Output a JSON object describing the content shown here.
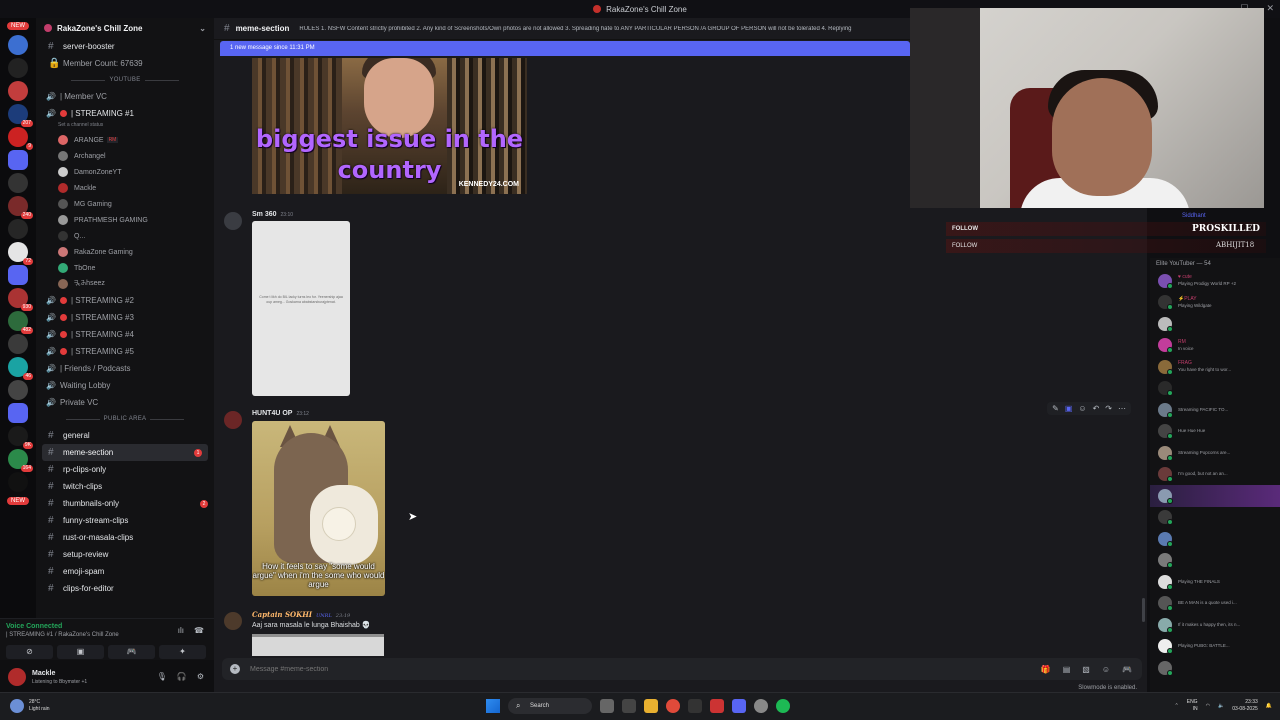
{
  "window": {
    "title": "RakaZone's Chill Zone"
  },
  "server": {
    "name": "RakaZone's Chill Zone",
    "new_label": "NEW",
    "rail_badges": [
      "207",
      "9",
      "240",
      "72",
      "930",
      "482",
      "46",
      "9K",
      "164"
    ]
  },
  "sidebar": {
    "top_channels": [
      {
        "name": "server-booster",
        "type": "text"
      },
      {
        "name": "Member Count: 67639",
        "type": "voice"
      }
    ],
    "youtube_category": "YOUTUBE",
    "member_vc": "| Member VC",
    "streaming1": "| STREAMING #1",
    "streaming1_status": "Set a channel status",
    "vc_users": [
      {
        "name": "ARANGE",
        "tag": "RM"
      },
      {
        "name": "Archangel",
        "tag": ""
      },
      {
        "name": "DamonZoneYT",
        "tag": ""
      },
      {
        "name": "Mackle",
        "tag": ""
      },
      {
        "name": "MG Gaming",
        "tag": ""
      },
      {
        "name": "PRATHMESH GAMING",
        "tag": ""
      },
      {
        "name": "Q...",
        "tag": ""
      },
      {
        "name": "RakaZone Gaming",
        "tag": ""
      },
      {
        "name": "TbOne",
        "tag": ""
      },
      {
        "name": "ꔩꔕhseez",
        "tag": ""
      }
    ],
    "other_vcs": [
      "| STREAMING #2",
      "| STREAMING #3",
      "| STREAMING #4",
      "| STREAMING #5",
      "| Friends / Podcasts",
      "Waiting Lobby",
      "Private VC"
    ],
    "public_category": "PUBLIC AREA",
    "text_channels": [
      {
        "name": "general",
        "unread": ""
      },
      {
        "name": "meme-section",
        "unread": "1"
      },
      {
        "name": "rp-clips-only",
        "unread": ""
      },
      {
        "name": "twitch-clips",
        "unread": ""
      },
      {
        "name": "thumbnails-only",
        "unread": "2"
      },
      {
        "name": "funny-stream-clips",
        "unread": ""
      },
      {
        "name": "rust-or-masala-clips",
        "unread": ""
      },
      {
        "name": "setup-review",
        "unread": ""
      },
      {
        "name": "emoji-spam",
        "unread": ""
      },
      {
        "name": "clips-for-editor",
        "unread": ""
      }
    ]
  },
  "voice_panel": {
    "status": "Voice Connected",
    "channel": "| STREAMING #1 / RakaZone's Chill Zone"
  },
  "user_panel": {
    "name": "Mackle",
    "status": "Listening to Bbymster +1"
  },
  "channel": {
    "name": "meme-section",
    "topic": "RULES 1. NSFW Content strictly prohibited 2. Any kind of Screenshots/Own photos are not allowed 3. Spreading hate to ANY PARTICULAR PERSON /A GROUP OF PERSON will not be tolerated 4. Replying",
    "new_message_bar": "1 new message since 11:31 PM"
  },
  "messages": [
    {
      "author": "",
      "time": "",
      "image_caption": "biggest issue in the country",
      "watermark": "KENNEDY24.COM"
    },
    {
      "author": "Sm 360",
      "time": "23:10",
      "image_text": "Come t likh do BIL lacky turns leo for. Yeenership ajaa oup ameg... Goskarna ababstarsburajptenat."
    },
    {
      "author": "HUNT4U OP",
      "time": "23:12",
      "image_caption": "How it feels to say \"some would argue\" when i'm the some who would argue"
    },
    {
      "author": "Captain SOKHI",
      "tag": "UNRL",
      "time": "23:19",
      "text": "Aaj sara masala le lunga Bhaishab 💀"
    }
  ],
  "composer": {
    "placeholder": "Message #meme-section",
    "slowmode": "Slowmode is enabled."
  },
  "stream_overlay": {
    "follow1": "FOLLOW",
    "follow2": "FOLLOW",
    "name1": "PROSKILLED",
    "name2": "ABHIJIT18",
    "top_member": "Siddhant"
  },
  "members": {
    "category": "Elite YouTuber — 54",
    "list": [
      {
        "name": "♥ cute",
        "activity": "Playing Prodigy World RP +2"
      },
      {
        "name": "⚡PLAY",
        "activity": "Playing Wildgate"
      },
      {
        "name": "",
        "activity": ""
      },
      {
        "name": "RM",
        "activity": "In voice"
      },
      {
        "name": "FRAG",
        "activity": "You have the right to wor..."
      },
      {
        "name": "",
        "activity": ""
      },
      {
        "name": "",
        "activity": "Streaming PACIFIC TO..."
      },
      {
        "name": "",
        "activity": "Hue Hue Hue"
      },
      {
        "name": "",
        "activity": "Streaming Popcorns are..."
      },
      {
        "name": "",
        "activity": "I'm good, but not an an..."
      },
      {
        "name": "",
        "activity": ""
      },
      {
        "name": "",
        "activity": ""
      },
      {
        "name": "",
        "activity": ""
      },
      {
        "name": "",
        "activity": ""
      },
      {
        "name": "",
        "activity": "Playing THE FINALS"
      },
      {
        "name": "",
        "activity": "BE A MAN is a quote used i..."
      },
      {
        "name": "",
        "activity": "If it makes u happy then, its n..."
      },
      {
        "name": "",
        "activity": "Playing PUBG: BATTLE..."
      },
      {
        "name": "",
        "activity": ""
      }
    ]
  },
  "taskbar": {
    "weather_temp": "28°C",
    "weather_desc": "Light rain",
    "search": "Search",
    "lang1": "ENG",
    "lang2": "IN",
    "time": "23:33",
    "date": "03-08-2025"
  },
  "colors": {
    "accent": "#5865f2",
    "danger": "#e23b3b",
    "online": "#23a55a",
    "member_name": "#c23d6b"
  }
}
